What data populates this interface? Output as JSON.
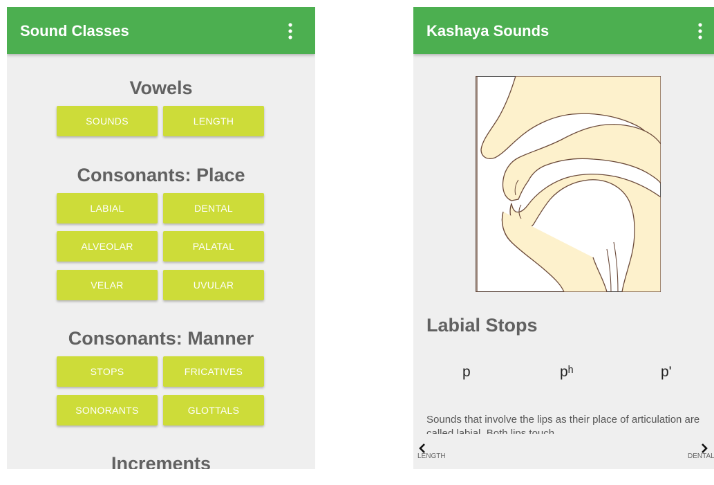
{
  "left_screen": {
    "title": "Sound Classes",
    "sections": [
      {
        "title": "Vowels",
        "buttons": [
          "SOUNDS",
          "LENGTH"
        ]
      },
      {
        "title": "Consonants: Place",
        "buttons": [
          "LABIAL",
          "DENTAL",
          "ALVEOLAR",
          "PALATAL",
          "VELAR",
          "UVULAR"
        ]
      },
      {
        "title": "Consonants: Manner",
        "buttons": [
          "STOPS",
          "FRICATIVES",
          "SONORANTS",
          "GLOTTALS"
        ]
      },
      {
        "title": "Increments",
        "buttons": []
      }
    ]
  },
  "right_screen": {
    "title": "Kashaya Sounds",
    "heading": "Labial Stops",
    "phones": [
      "p",
      "pʰ",
      "p'"
    ],
    "description": "Sounds that involve the lips as their place of articulation are called labial. Both lips touch ...",
    "nav": {
      "prev_label": "LENGTH",
      "next_label": "DENTAL"
    }
  },
  "colors": {
    "appbar": "#4caf50",
    "button": "#cddc39",
    "background": "#efefef",
    "diagram_fill": "#fdf1cc",
    "heading_text": "#616161"
  },
  "icons": [
    "overflow-menu-icon",
    "chevron-left-icon",
    "chevron-right-icon"
  ]
}
